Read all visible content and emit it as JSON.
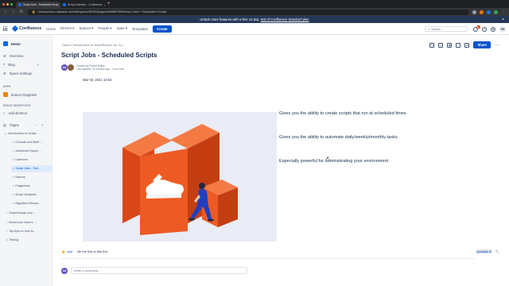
{
  "browser": {
    "tabs": [
      {
        "label": "Script Jobs - Scheduled Scrip",
        "active": true
      },
      {
        "label": "Script Listeners - Confluence",
        "active": false
      }
    ],
    "url": "i.ttarkey/demo.atlassian.net/wiki/spaces/DEMO/pages/4068887906/Script+Jobs+-+Scheduled+Scripts"
  },
  "banner": {
    "text": "Unlock more features with a free 14-day",
    "link": "trial of Confluence Standard plan",
    "close": "×"
  },
  "topnav": {
    "logo": "Confluence",
    "items": [
      "Home",
      "Recent ▾",
      "Spaces ▾",
      "People ▾",
      "Apps ▾",
      "Templates"
    ],
    "create": "Create",
    "search_placeholder": "Search",
    "notification_count": "9+",
    "user_initials": "RB"
  },
  "sidebar": {
    "space_name": "Demo",
    "overview": "Overview",
    "blog": "Blog",
    "space_settings": "Space Settings",
    "apps_header": "APPS",
    "app_item": "draw.io Diagrams",
    "shortcuts_header": "SPACE SHORTCUTS",
    "add_shortcut": "Add shortcut",
    "pages_label": "Pages",
    "tree": [
      "Introduction to Script...",
      "Console and Built ...",
      "Advanced Space ...",
      "Listeners",
      "Script Jobs - Sch...",
      "Macros",
      "Fragments",
      "Script Variables",
      "Migration Resour..."
    ],
    "extra_pages": [
      "Supercharge your ...",
      "Boost your team's ...",
      "Top tips on how to...",
      "Testing"
    ]
  },
  "page": {
    "breadcrumbs": "Demo   /   Introduction to ScriptRunner for Co...",
    "share": "Share",
    "title": "Script Jobs - Scheduled Scripts",
    "created_by": "Created by Robert Bailey",
    "last_updated": "Last updated: 33 minutes ago  ·  1 min read",
    "author_initials": "RB",
    "date": "Mar 03, 2021 10:53",
    "bullets": [
      "Gives you the ability to create scripts that run at scheduled times",
      "Gives you the ability to automate daily/weekly/monthly tasks",
      "Especially powerful for administrating your environment"
    ],
    "like_label": "Like",
    "like_text": "Be the first to like this",
    "label_tag": "goodbye ▾",
    "comment_initials": "RB",
    "comment_placeholder": "Write a comment..."
  },
  "colors": {
    "accent": "#0052cc",
    "banner": "#253858",
    "hero_bg": "#e9ecf5",
    "hero_orange": "#ee5a24",
    "figure_blue": "#1f3fbf"
  }
}
